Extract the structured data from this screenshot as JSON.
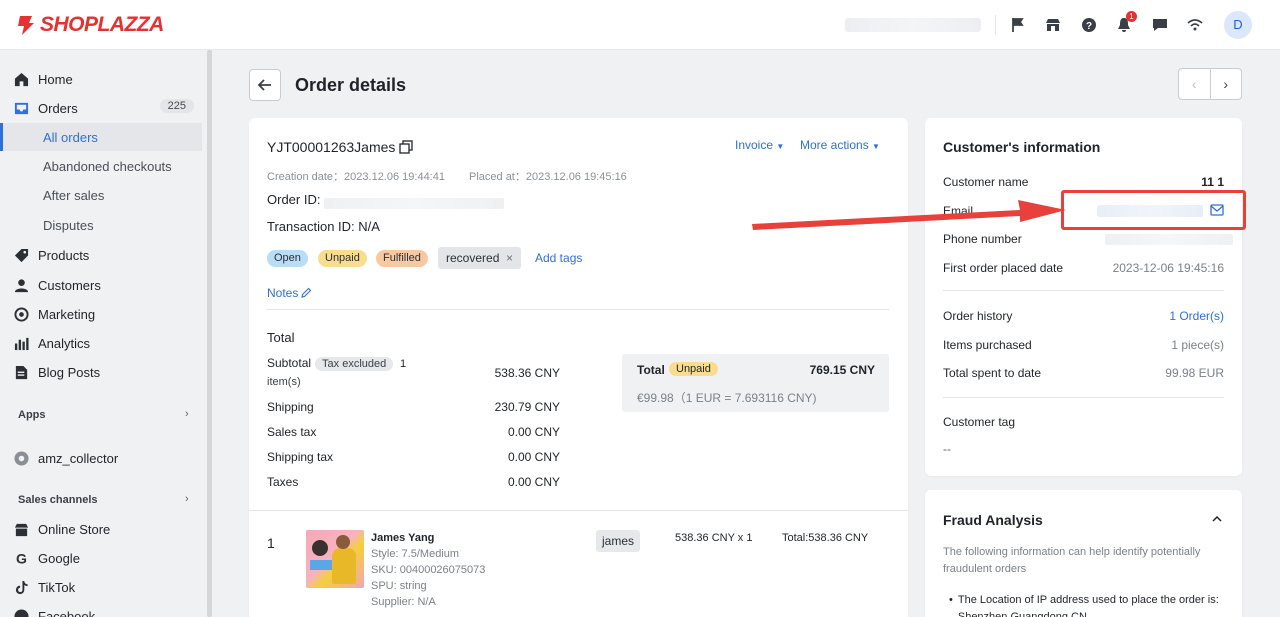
{
  "app": {
    "brand": "SHOPLAZZA",
    "avatar_initial": "D",
    "notification_count": "1",
    "accent": "#2e6fd8",
    "brand_color": "#e3322f"
  },
  "sidebar": {
    "items": [
      {
        "label": "Home",
        "icon": "home-icon"
      },
      {
        "label": "Orders",
        "icon": "orders-icon",
        "count": "225"
      },
      {
        "label": "Products",
        "icon": "tag-icon"
      },
      {
        "label": "Customers",
        "icon": "person-icon"
      },
      {
        "label": "Marketing",
        "icon": "target-icon"
      },
      {
        "label": "Analytics",
        "icon": "bar-chart-icon"
      },
      {
        "label": "Blog Posts",
        "icon": "document-icon"
      }
    ],
    "order_sub": [
      "All orders",
      "Abandoned checkouts",
      "After sales",
      "Disputes"
    ],
    "apps_label": "Apps",
    "app_item": "amz_collector",
    "sales_channels_label": "Sales channels",
    "channels": [
      "Online Store",
      "Google",
      "TikTok",
      "Facebook"
    ]
  },
  "header": {
    "title": "Order details",
    "back": "←",
    "prev": "‹",
    "next": "›"
  },
  "order": {
    "number": "YJT00001263James",
    "invoice": "Invoice",
    "more_actions": "More actions",
    "creation_label": "Creation date：",
    "creation_date": "2023.12.06 19:44:41",
    "placed_label": "Placed at：",
    "placed_at": "2023.12.06 19:45:16",
    "order_id_label": "Order ID:",
    "transaction_label": "Transaction ID: N/A",
    "tags": {
      "open": "Open",
      "unpaid": "Unpaid",
      "fulfilled": "Fulfilled",
      "recovered": "recovered",
      "remove": "×",
      "add": "Add tags"
    },
    "notes": "Notes"
  },
  "totals": {
    "heading": "Total",
    "subtotal_label": "Subtotal",
    "tax_excluded": "Tax excluded",
    "items_count": "1",
    "items_suffix": "item(s)",
    "subtotal": "538.36 CNY",
    "shipping_label": "Shipping",
    "shipping": "230.79 CNY",
    "sales_tax_label": "Sales tax",
    "sales_tax": "0.00 CNY",
    "shipping_tax_label": "Shipping tax",
    "shipping_tax": "0.00 CNY",
    "taxes_label": "Taxes",
    "taxes": "0.00 CNY",
    "box_label": "Total",
    "box_status": "Unpaid",
    "box_total": "769.15 CNY",
    "box_eur": "€99.98（1 EUR = 7.693116 CNY)"
  },
  "line_item": {
    "index": "1",
    "name": "James Yang",
    "style": "Style: 7.5/Medium",
    "sku": "SKU: 00400026075073",
    "spu": "SPU: string",
    "supplier": "Supplier: N/A",
    "tag": "james",
    "qty_price": "538.36 CNY x 1",
    "total": "Total:538.36 CNY"
  },
  "customer": {
    "title": "Customer's information",
    "name_label": "Customer name",
    "name_value": "11 1",
    "email_label": "Email",
    "phone_label": "Phone number",
    "first_order_label": "First order placed date",
    "first_order_value": "2023-12-06 19:45:16",
    "history_label": "Order history",
    "history_value": "1 Order(s)",
    "items_label": "Items purchased",
    "items_value": "1 piece(s)",
    "spent_label": "Total spent to date",
    "spent_value": "99.98 EUR",
    "tag_label": "Customer tag",
    "tag_value": "--"
  },
  "fraud": {
    "title": "Fraud Analysis",
    "desc": "The following information can help identify potentially fraudulent orders",
    "bullet": "The Location of IP address used to place the order is: Shenzhen,Guangdong,CN"
  }
}
